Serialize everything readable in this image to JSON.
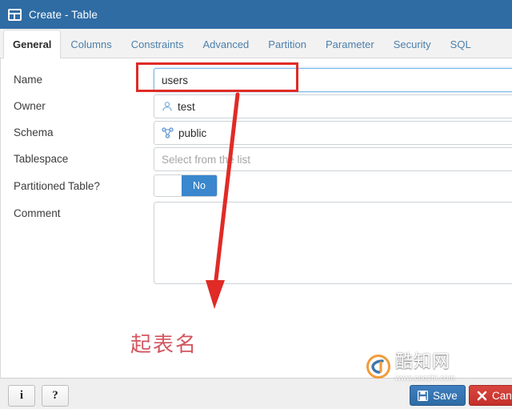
{
  "window": {
    "title": "Create - Table",
    "icon": "table-icon"
  },
  "tabs": [
    {
      "label": "General",
      "active": true
    },
    {
      "label": "Columns",
      "active": false
    },
    {
      "label": "Constraints",
      "active": false
    },
    {
      "label": "Advanced",
      "active": false
    },
    {
      "label": "Partition",
      "active": false
    },
    {
      "label": "Parameter",
      "active": false
    },
    {
      "label": "Security",
      "active": false
    },
    {
      "label": "SQL",
      "active": false
    }
  ],
  "form": {
    "name": {
      "label": "Name",
      "value": "users",
      "placeholder": "",
      "focused": true,
      "highlighted": true
    },
    "owner": {
      "label": "Owner",
      "value": "test",
      "icon": "user-icon"
    },
    "schema": {
      "label": "Schema",
      "value": "public",
      "icon": "schema-icon"
    },
    "tablespace": {
      "label": "Tablespace",
      "value": "",
      "placeholder": "Select from the list"
    },
    "partitioned": {
      "label": "Partitioned Table?",
      "value": "No",
      "on_label": "No"
    },
    "comment": {
      "label": "Comment",
      "value": ""
    }
  },
  "annotation": {
    "text": "起表名",
    "color": "#d3565f",
    "box_color": "#e02b26",
    "arrow_color": "#e02b26"
  },
  "watermark": {
    "brand": "酷知网",
    "url": "www.coozhi.com"
  },
  "footer": {
    "info_label": "i",
    "help_label": "?",
    "save_label": "Save",
    "cancel_label": "Cancel"
  },
  "colors": {
    "titlebar": "#2f6ca4",
    "accent": "#3a87cd",
    "save": "#2f6ca4",
    "cancel": "#c4302b",
    "tab_inactive": "#4b7fab"
  }
}
